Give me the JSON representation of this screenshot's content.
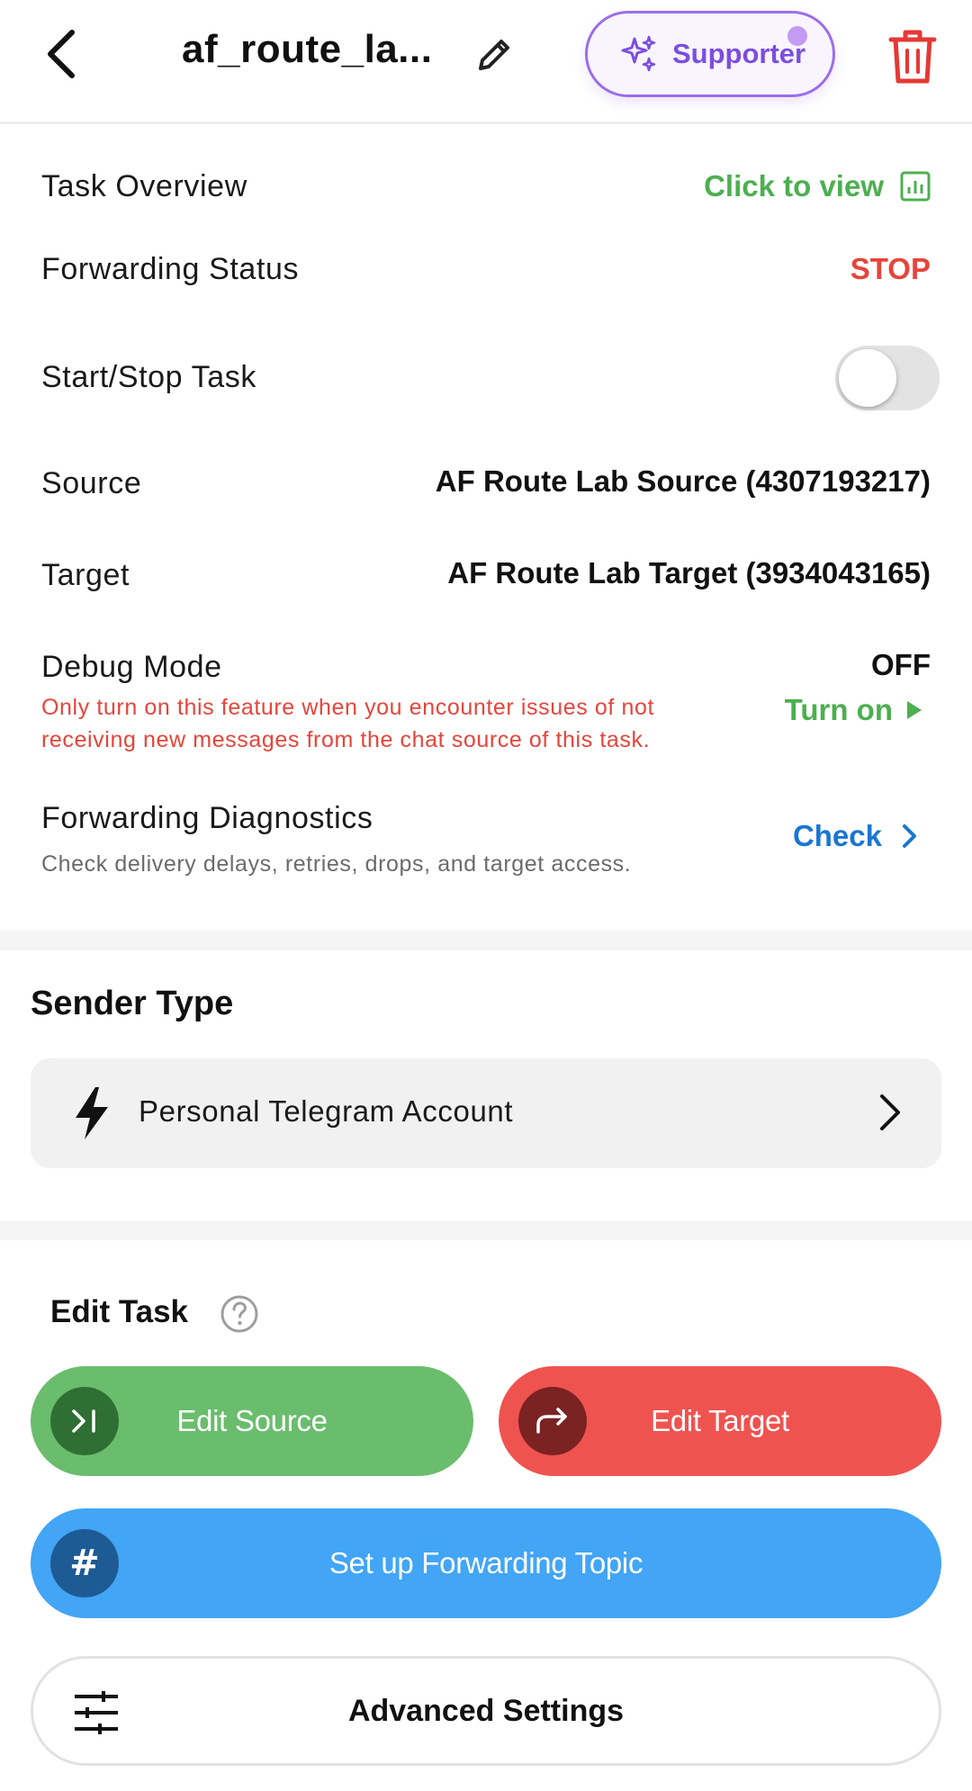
{
  "header": {
    "title": "af_route_la...",
    "supporter_label": "Supporter"
  },
  "overview": {
    "task_overview_label": "Task Overview",
    "task_overview_action": "Click to view",
    "forwarding_status_label": "Forwarding Status",
    "forwarding_status_value": "STOP",
    "start_stop_label": "Start/Stop Task",
    "start_stop_on": false,
    "source_label": "Source",
    "source_value": "AF Route Lab Source (4307193217)",
    "target_label": "Target",
    "target_value": "AF Route Lab Target (3934043165)",
    "debug_label": "Debug Mode",
    "debug_value": "OFF",
    "debug_action": "Turn on",
    "debug_warning": "Only turn on this feature when you encounter issues of not receiving new messages from the chat source of this task.",
    "diagnostics_label": "Forwarding Diagnostics",
    "diagnostics_hint": "Check delivery delays, retries, drops, and target access.",
    "diagnostics_action": "Check"
  },
  "sender": {
    "title": "Sender Type",
    "value": "Personal Telegram Account"
  },
  "edit_task": {
    "title": "Edit Task",
    "edit_source": "Edit Source",
    "edit_target": "Edit Target",
    "forwarding_topic": "Set up Forwarding Topic",
    "advanced_settings": "Advanced Settings"
  },
  "colors": {
    "green": "#4caf50",
    "red": "#e5453b",
    "blue": "#1976d2",
    "purple": "#7c4ee0"
  },
  "icons": [
    "back-arrow-icon",
    "pencil-icon",
    "sparkles-icon",
    "trash-icon",
    "chart-icon",
    "play-icon",
    "chevron-right-icon",
    "bolt-icon",
    "help-icon",
    "skip-to-end-icon",
    "share-arrow-icon",
    "hash-icon",
    "sliders-icon"
  ]
}
